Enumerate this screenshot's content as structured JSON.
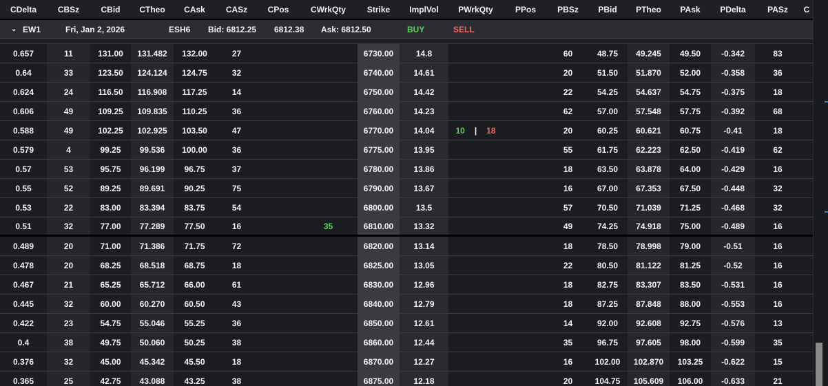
{
  "columns": [
    "CDelta",
    "CBSz",
    "CBid",
    "CTheo",
    "CAsk",
    "CASz",
    "CPos",
    "CWrkQty",
    "Strike",
    "ImplVol",
    "PWrkQty",
    "PPos",
    "PBSz",
    "PBid",
    "PTheo",
    "PAsk",
    "PDelta",
    "PASz",
    "C"
  ],
  "group": {
    "name": "EW1",
    "date": "Fri, Jan 2, 2026",
    "symbol": "ESH6",
    "bid": "Bid: 6812.25",
    "mid": "6812.38",
    "ask": "Ask: 6812.50",
    "buy": "BUY",
    "sell": "SELL"
  },
  "rows": [
    [
      "0.657",
      "11",
      "131.00",
      "131.482",
      "132.00",
      "27",
      "",
      "",
      "6730.00",
      "14.8",
      "",
      "",
      "60",
      "48.75",
      "49.245",
      "49.50",
      "-0.342",
      "83"
    ],
    [
      "0.64",
      "33",
      "123.50",
      "124.124",
      "124.75",
      "32",
      "",
      "",
      "6740.00",
      "14.61",
      "",
      "",
      "20",
      "51.50",
      "51.870",
      "52.00",
      "-0.358",
      "36"
    ],
    [
      "0.624",
      "24",
      "116.50",
      "116.908",
      "117.25",
      "14",
      "",
      "",
      "6750.00",
      "14.42",
      "",
      "",
      "22",
      "54.25",
      "54.637",
      "54.75",
      "-0.375",
      "18"
    ],
    [
      "0.606",
      "49",
      "109.25",
      "109.835",
      "110.25",
      "36",
      "",
      "",
      "6760.00",
      "14.23",
      "",
      "",
      "62",
      "57.00",
      "57.548",
      "57.75",
      "-0.392",
      "68"
    ],
    [
      "0.588",
      "49",
      "102.25",
      "102.925",
      "103.50",
      "47",
      "",
      "",
      "6770.00",
      "14.04",
      "",
      "",
      "20",
      "60.25",
      "60.621",
      "60.75",
      "-0.41",
      "18"
    ],
    [
      "0.579",
      "4",
      "99.25",
      "99.536",
      "100.00",
      "36",
      "",
      "",
      "6775.00",
      "13.95",
      "",
      "",
      "55",
      "61.75",
      "62.223",
      "62.50",
      "-0.419",
      "62"
    ],
    [
      "0.57",
      "53",
      "95.75",
      "96.199",
      "96.75",
      "37",
      "",
      "",
      "6780.00",
      "13.86",
      "",
      "",
      "18",
      "63.50",
      "63.878",
      "64.00",
      "-0.429",
      "16"
    ],
    [
      "0.55",
      "52",
      "89.25",
      "89.691",
      "90.25",
      "75",
      "",
      "",
      "6790.00",
      "13.67",
      "",
      "",
      "16",
      "67.00",
      "67.353",
      "67.50",
      "-0.448",
      "32"
    ],
    [
      "0.53",
      "22",
      "83.00",
      "83.394",
      "83.75",
      "54",
      "",
      "",
      "6800.00",
      "13.5",
      "",
      "",
      "57",
      "70.50",
      "71.039",
      "71.25",
      "-0.468",
      "32"
    ],
    [
      "0.51",
      "32",
      "77.00",
      "77.289",
      "77.50",
      "16",
      "",
      "35",
      "6810.00",
      "13.32",
      "",
      "",
      "49",
      "74.25",
      "74.918",
      "75.00",
      "-0.489",
      "16"
    ],
    [
      "0.489",
      "20",
      "71.00",
      "71.386",
      "71.75",
      "72",
      "",
      "",
      "6820.00",
      "13.14",
      "",
      "",
      "18",
      "78.50",
      "78.998",
      "79.00",
      "-0.51",
      "16"
    ],
    [
      "0.478",
      "20",
      "68.25",
      "68.518",
      "68.75",
      "18",
      "",
      "",
      "6825.00",
      "13.05",
      "",
      "",
      "22",
      "80.50",
      "81.122",
      "81.25",
      "-0.52",
      "16"
    ],
    [
      "0.467",
      "21",
      "65.25",
      "65.712",
      "66.00",
      "61",
      "",
      "",
      "6830.00",
      "12.96",
      "",
      "",
      "18",
      "82.75",
      "83.307",
      "83.50",
      "-0.531",
      "16"
    ],
    [
      "0.445",
      "32",
      "60.00",
      "60.270",
      "60.50",
      "43",
      "",
      "",
      "6840.00",
      "12.79",
      "",
      "",
      "18",
      "87.25",
      "87.848",
      "88.00",
      "-0.553",
      "16"
    ],
    [
      "0.422",
      "23",
      "54.75",
      "55.046",
      "55.25",
      "36",
      "",
      "",
      "6850.00",
      "12.61",
      "",
      "",
      "14",
      "92.00",
      "92.608",
      "92.75",
      "-0.576",
      "13"
    ],
    [
      "0.4",
      "38",
      "49.75",
      "50.060",
      "50.25",
      "38",
      "",
      "",
      "6860.00",
      "12.44",
      "",
      "",
      "35",
      "96.75",
      "97.605",
      "98.00",
      "-0.599",
      "35"
    ],
    [
      "0.376",
      "32",
      "45.00",
      "45.342",
      "45.50",
      "18",
      "",
      "",
      "6870.00",
      "12.27",
      "",
      "",
      "16",
      "102.00",
      "102.870",
      "103.25",
      "-0.622",
      "15"
    ],
    [
      "0.365",
      "25",
      "42.75",
      "43.088",
      "43.25",
      "38",
      "",
      "",
      "6875.00",
      "12.18",
      "",
      "",
      "20",
      "104.75",
      "105.609",
      "106.00",
      "-0.633",
      "21"
    ]
  ],
  "working": {
    "row": 4,
    "buy": "10",
    "divider": "|",
    "sell": "18"
  }
}
